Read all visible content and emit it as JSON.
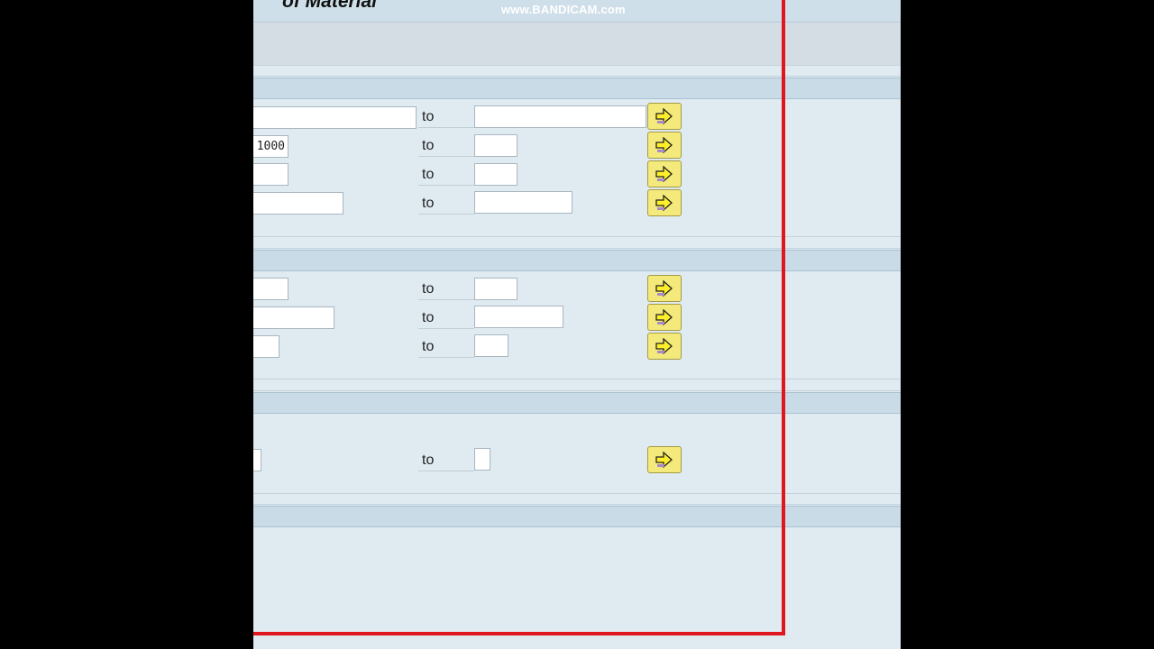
{
  "window": {
    "title_fragment": "of Material"
  },
  "watermark": "www.BANDICAM.com",
  "range_separator": "to",
  "sections": [
    {
      "rows": [
        {
          "from_value": "",
          "to_value": ""
        },
        {
          "from_value": "1000",
          "to_value": ""
        },
        {
          "from_value": "",
          "to_value": ""
        },
        {
          "from_value": "",
          "to_value": ""
        }
      ]
    },
    {
      "rows": [
        {
          "from_value": "",
          "to_value": ""
        },
        {
          "from_value": "",
          "to_value": ""
        },
        {
          "from_value": "",
          "to_value": ""
        }
      ]
    },
    {
      "rows": [
        {
          "from_value": "",
          "to_value": ""
        }
      ]
    }
  ],
  "icons": {
    "multiple_selection": "arrow-right-icon"
  },
  "colors": {
    "highlight": "#e0161f",
    "button": "#f4ea7c",
    "background": "#dfeaf1"
  }
}
